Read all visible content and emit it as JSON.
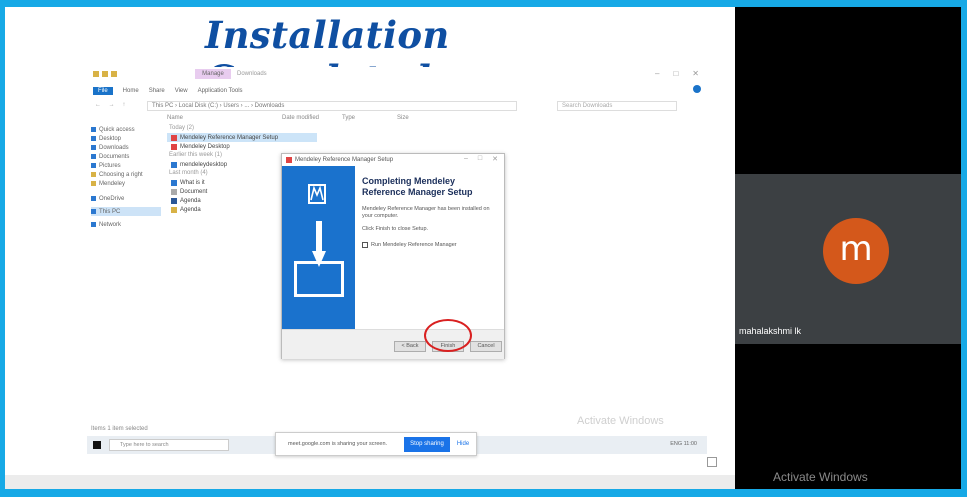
{
  "slide": {
    "title": "Installation Completed"
  },
  "explorer": {
    "manage_tab": "Manage",
    "menu": [
      "File",
      "Home",
      "Share",
      "View",
      "Application Tools"
    ],
    "address": "This PC › Local Disk (C:) › Users › ... › Downloads",
    "search_placeholder": "Search Downloads",
    "columns": [
      "Name",
      "Date modified",
      "Type",
      "Size"
    ],
    "nav_items": [
      "Quick access",
      "Desktop",
      "Downloads",
      "Documents",
      "Pictures",
      "Choosing a right",
      "Mendeley",
      "OneDrive",
      "This PC",
      "Network"
    ],
    "groups": [
      "Today (2)",
      "Earlier this week (1)",
      "Last month (4)"
    ],
    "files_today": [
      "Mendeley Reference Manager Setup",
      "Mendeley Desktop"
    ],
    "files_week": [
      "mendeleydesktop"
    ],
    "files_month": [
      "What is it",
      "Document",
      "Agenda",
      "Agenda"
    ],
    "status": "Items   1 item selected"
  },
  "dialog": {
    "title": "Mendeley Reference Manager Setup",
    "heading": "Completing Mendeley Reference Manager Setup",
    "body1": "Mendeley Reference Manager has been installed on your computer.",
    "body2": "Click Finish to close Setup.",
    "checkbox_label": "Run Mendeley Reference Manager",
    "back_label": "< Back",
    "finish_label": "Finish",
    "cancel_label": "Cancel"
  },
  "taskbar": {
    "search_placeholder": "Type here to search",
    "tray": "ENG  11:00"
  },
  "sharebar": {
    "message": "meet.google.com is sharing your screen.",
    "stop_label": "Stop sharing",
    "hide_label": "Hide"
  },
  "overlay": {
    "activate_slide": "Activate Windows",
    "activate_panel": "Activate Windows"
  },
  "participant": {
    "initial": "m",
    "name": "mahalakshmi lk"
  },
  "colors": {
    "border": "#17a9e6",
    "title": "#0f4fa2",
    "banner": "#1a72cd",
    "avatar": "#d4581b",
    "highlight_ring": "#d92020"
  }
}
